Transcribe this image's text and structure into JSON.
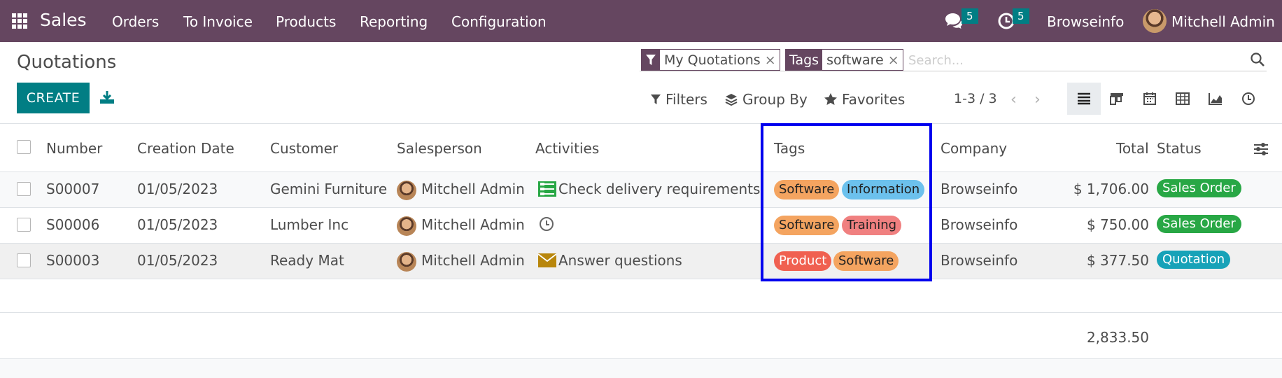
{
  "navbar": {
    "brand": "Sales",
    "menu": [
      "Orders",
      "To Invoice",
      "Products",
      "Reporting",
      "Configuration"
    ],
    "messages_count": "5",
    "activities_count": "5",
    "company": "Browseinfo",
    "user": "Mitchell Admin",
    "bg_color": "#654660"
  },
  "control": {
    "title": "Quotations",
    "create_label": "CREATE",
    "facets": [
      {
        "label_icon": "filter-icon",
        "value": "My Quotations"
      },
      {
        "label": "Tags",
        "value": "software"
      }
    ],
    "facet_remove": "×",
    "search_placeholder": "Search...",
    "filters_label": "Filters",
    "groupby_label": "Group By",
    "favorites_label": "Favorites",
    "pager": "1-3 / 3",
    "views": [
      "list-view-icon",
      "kanban-view-icon",
      "calendar-view-icon",
      "pivot-view-icon",
      "graph-view-icon",
      "activity-view-icon"
    ],
    "active_view": "list-view-icon"
  },
  "table": {
    "headers": {
      "number": "Number",
      "creation_date": "Creation Date",
      "customer": "Customer",
      "salesperson": "Salesperson",
      "activities": "Activities",
      "tags": "Tags",
      "company": "Company",
      "total": "Total",
      "status": "Status"
    },
    "rows": [
      {
        "number": "S00007",
        "date": "01/05/2023",
        "customer": "Gemini Furniture",
        "salesperson": "Mitchell Admin",
        "activity_icon": "checklist-icon",
        "activity": "Check delivery requirements",
        "tags": [
          {
            "label": "Software",
            "color": "#f4a460"
          },
          {
            "label": "Information",
            "color": "#6cc1ed"
          }
        ],
        "company": "Browseinfo",
        "total": "$ 1,706.00",
        "status": "Sales Order",
        "status_color": "#28a745"
      },
      {
        "number": "S00006",
        "date": "01/05/2023",
        "customer": "Lumber Inc",
        "salesperson": "Mitchell Admin",
        "activity_icon": "clock-icon",
        "activity": "",
        "tags": [
          {
            "label": "Software",
            "color": "#f4a460"
          },
          {
            "label": "Training",
            "color": "#f08080"
          }
        ],
        "company": "Browseinfo",
        "total": "$ 750.00",
        "status": "Sales Order",
        "status_color": "#28a745"
      },
      {
        "number": "S00003",
        "date": "01/05/2023",
        "customer": "Ready Mat",
        "salesperson": "Mitchell Admin",
        "activity_icon": "envelope-icon",
        "activity": "Answer questions",
        "tags": [
          {
            "label": "Product",
            "color": "#f06050"
          },
          {
            "label": "Software",
            "color": "#f4a460"
          }
        ],
        "company": "Browseinfo",
        "total": "$ 377.50",
        "status": "Quotation",
        "status_color": "#17a2b8"
      }
    ],
    "sum_total": "2,833.50"
  },
  "highlight_color": "#0000ee"
}
